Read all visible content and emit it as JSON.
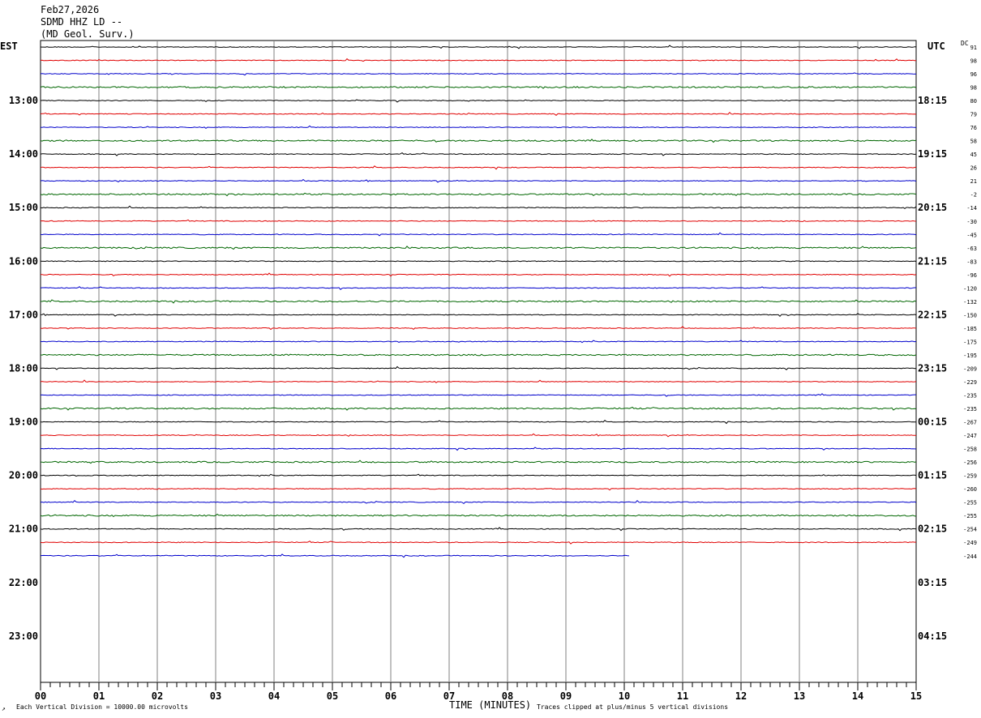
{
  "header": {
    "date": "Feb27,2026",
    "station": "SDMD HHZ LD --",
    "agency": "(MD Geol. Surv.)"
  },
  "left_axis_title": "EST",
  "right_axis_title": "UTC",
  "dc_title": "DC",
  "footer": {
    "scale_note": "Each Vertical Division = 10000.00 microvolts",
    "clip_note": "Traces clipped at plus/minus 5 vertical divisions",
    "corner_mark": "↗"
  },
  "colors": {
    "black": "#000000",
    "red": "#e00000",
    "blue": "#0000cc",
    "green": "#006600",
    "grid": "#808080"
  },
  "chart_data": {
    "type": "line",
    "title": "SDMD HHZ LD --",
    "xlabel": "TIME (MINUTES)",
    "x_ticks": [
      "00",
      "01",
      "02",
      "03",
      "04",
      "05",
      "06",
      "07",
      "08",
      "09",
      "10",
      "11",
      "12",
      "13",
      "14",
      "15"
    ],
    "xlim": [
      0,
      15
    ],
    "minutes_per_row": 15,
    "rows_per_hour": 4,
    "est_hour_labels": [
      "13:00",
      "14:00",
      "15:00",
      "16:00",
      "17:00",
      "18:00",
      "19:00",
      "20:00",
      "21:00",
      "22:00",
      "23:00"
    ],
    "utc_hour_labels": [
      "18:15",
      "19:15",
      "20:15",
      "21:15",
      "22:15",
      "23:15",
      "00:15",
      "01:15",
      "02:15",
      "03:15",
      "04:15"
    ],
    "trace_color_cycle": [
      "black",
      "red",
      "blue",
      "green"
    ],
    "trace_count": 39,
    "last_trace_end_minute": 10.1,
    "dc_offsets": [
      "91",
      "98",
      "96",
      "98",
      "80",
      "79",
      "76",
      "58",
      "45",
      "26",
      "21",
      "-2",
      "-14",
      "-30",
      "-45",
      "-63",
      "-83",
      "-96",
      "-120",
      "-132",
      "-150",
      "-185",
      "-175",
      "-195",
      "-209",
      "-229",
      "-235",
      "-235",
      "-267",
      "-247",
      "-258",
      "-256",
      "-259",
      "-260",
      "-255",
      "-255",
      "-254",
      "-249",
      "-244"
    ]
  }
}
